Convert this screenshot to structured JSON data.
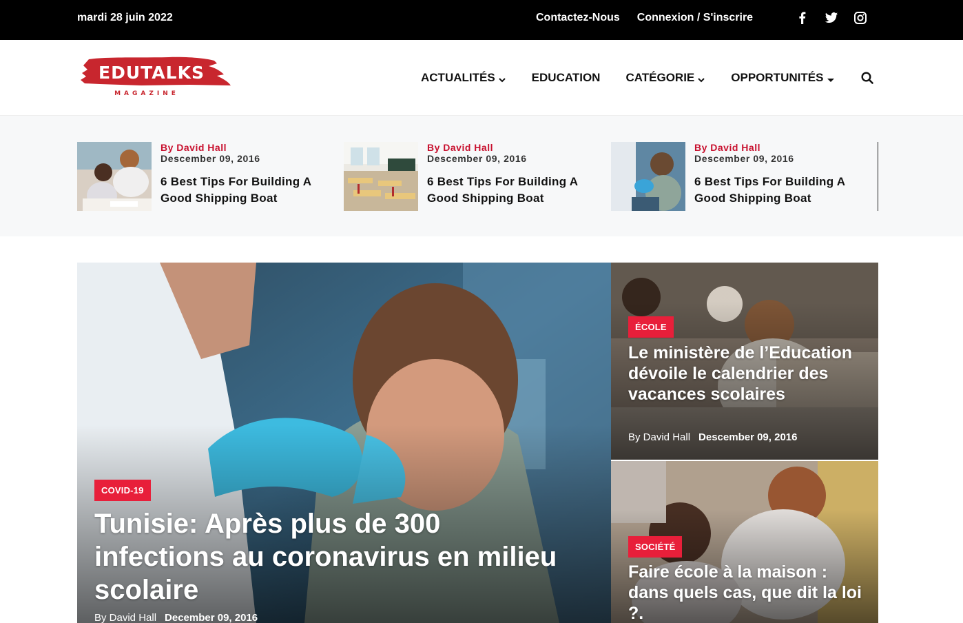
{
  "topbar": {
    "date": "mardi 28 juin 2022",
    "contact": "Contactez-Nous",
    "login": "Connexion / S'inscrire",
    "social_icons": [
      "facebook-icon",
      "twitter-icon",
      "instagram-icon"
    ]
  },
  "header": {
    "logo_text": "EDUTALKS",
    "logo_sub": "MAGAZINE",
    "nav": [
      {
        "label": "ACTUALITÉS",
        "dropdown": true
      },
      {
        "label": "EDUCATION",
        "dropdown": false
      },
      {
        "label": "CATÉGORIE",
        "dropdown": true
      },
      {
        "label": "OPPORTUNITÉS",
        "dropdown": true
      }
    ],
    "search_icon": "search-icon"
  },
  "ticker": [
    {
      "author": "By David Hall",
      "date": "Descember 09, 2016",
      "title": "6 Best Tips For Building A Good Shipping Boat"
    },
    {
      "author": "By David Hall",
      "date": "Descember 09, 2016",
      "title": "6 Best Tips For Building A Good Shipping Boat"
    },
    {
      "author": "By David Hall",
      "date": "Descember 09, 2016",
      "title": "6 Best Tips For Building A Good Shipping Boat"
    }
  ],
  "hero": {
    "category": "COVID-19",
    "title": "Tunisie: Après plus de 300 infections au coronavirus en milieu scolaire",
    "author": "By David Hall",
    "date": "December 09, 2016"
  },
  "side": [
    {
      "category": "ÉCOLE",
      "title": "Le ministère de l’Education dévoile le calendrier des vacances scolaires",
      "author": "By David Hall",
      "date": "Descember 09, 2016"
    },
    {
      "category": "SOCIÉTÉ",
      "title": "Faire école à la maison : dans quels cas, que dit la loi ?.",
      "author": "",
      "date": ""
    }
  ],
  "colors": {
    "accent": "#e81f3a",
    "topbar": "#000000",
    "author_red": "#c8102e",
    "ticker_bg": "#f7f8f9"
  }
}
